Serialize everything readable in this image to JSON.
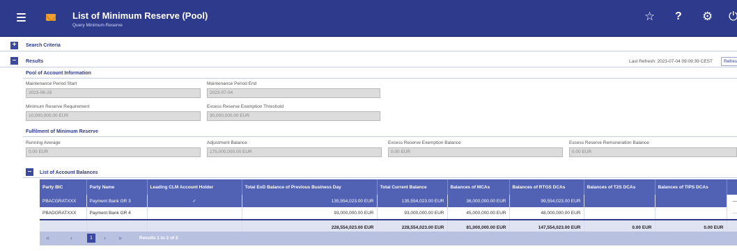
{
  "header": {
    "title": "List of Minimum Reserve (Pool)",
    "subtitle": "Query Minimum Reserve",
    "icons": {
      "menu": "☰",
      "star": "☆",
      "help": "?",
      "settings": "⚙",
      "power": "⏻"
    }
  },
  "search_criteria": {
    "toggle": "+",
    "title": "Search Criteria"
  },
  "results": {
    "toggle": "–",
    "title": "Results",
    "last_refresh": "Last Refresh: 2023-07-04 09:09:39 CEST",
    "refresh_button": "Refresh"
  },
  "pool": {
    "title": "Pool of Account Information",
    "maintenance_start_label": "Maintenance Period Start",
    "maintenance_start_value": "2023-06-28",
    "maintenance_end_label": "Maintenance Period End",
    "maintenance_end_value": "2023-07-04",
    "min_reserve_label": "Minimum Reserve Requirement",
    "min_reserve_value": "10,000,000.00 EUR",
    "exemption_threshold_label": "Excess Reserve Exemption Threshold",
    "exemption_threshold_value": "30,000,000.00 EUR"
  },
  "fulfilment": {
    "title": "Fulfilment of Minimum Reserve",
    "running_avg_label": "Running Average",
    "running_avg_value": "0.00 EUR",
    "adjustment_label": "Adjustment Balance",
    "adjustment_value": "175,000,000.00 EUR",
    "exemption_balance_label": "Excess Reserve Exemption Balance",
    "exemption_balance_value": "0.00 EUR",
    "remuneration_label": "Excess Reserve Remuneration Balance",
    "remuneration_value": "0.00 EUR"
  },
  "balances": {
    "toggle": "–",
    "title": "List of Account Balances",
    "columns": [
      "Party BIC",
      "Party Name",
      "Leading CLM Account Holder",
      "Total EoD Balance of Previous Business Day",
      "Total Current Balance",
      "Balances of MCAs",
      "Balances of RTGS DCAs",
      "Balances of T2S DCAs",
      "Balances of TIPS DCAs"
    ],
    "rows": [
      {
        "bic": "PBACGRATXXX",
        "name": "Payment Bank GR 3",
        "leading": "✓",
        "eod": "135,554,023.00 EUR",
        "current": "135,554,023.00 EUR",
        "mcas": "36,000,000.00 EUR",
        "rtgs": "99,554,023.00 EUR",
        "t2s": "",
        "tips": "",
        "action": "—"
      },
      {
        "bic": "PBADGRATXXX",
        "name": "Payment Bank GR 4",
        "leading": "",
        "eod": "93,000,000.00 EUR",
        "current": "93,000,000.00 EUR",
        "mcas": "45,000,000.00 EUR",
        "rtgs": "48,000,000.00 EUR",
        "t2s": "",
        "tips": "",
        "action": "···"
      }
    ],
    "totals": {
      "eod": "228,554,023.00 EUR",
      "current": "228,554,023.00 EUR",
      "mcas": "81,000,000.00 EUR",
      "rtgs": "147,554,023.00 EUR",
      "t2s": "0.00 EUR",
      "tips": "0.00 EUR"
    }
  },
  "pager": {
    "first": "«",
    "prev": "‹",
    "current": "1",
    "next": "›",
    "last": "»",
    "results": "Results 1 to 2 of 2"
  }
}
